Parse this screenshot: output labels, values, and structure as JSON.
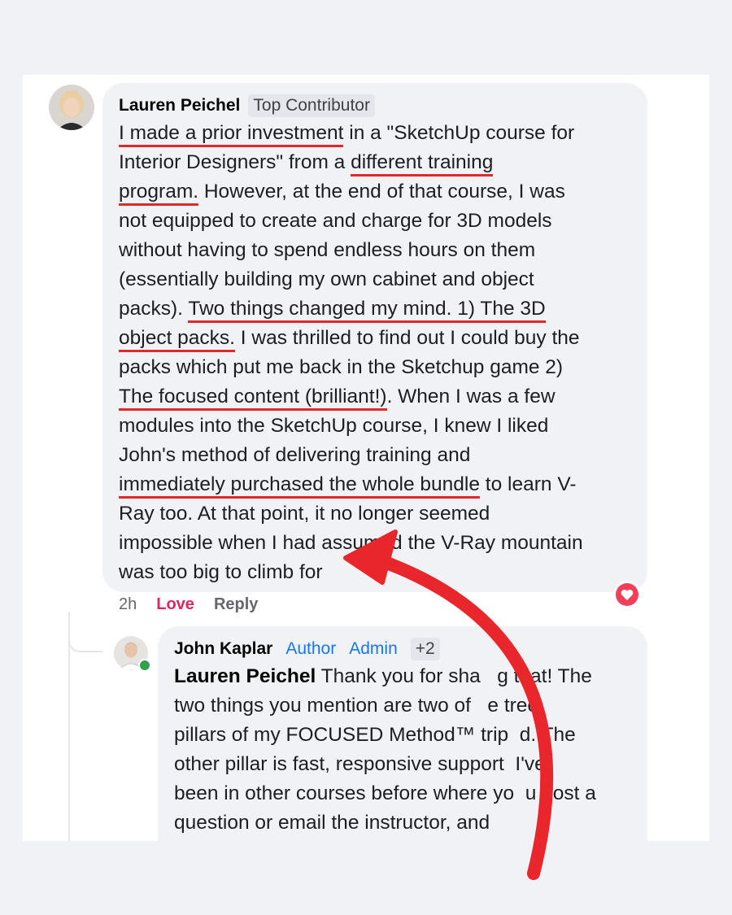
{
  "comment1": {
    "author": "Lauren Peichel",
    "badge": "Top Contributor",
    "lines": [
      [
        {
          "t": "I made a prior investment",
          "u": true
        },
        {
          "t": " in a \"SketchUp course for"
        }
      ],
      [
        {
          "t": "Interior Designers\" from a "
        },
        {
          "t": "different training",
          "u": true
        }
      ],
      [
        {
          "t": "program.",
          "u": true
        },
        {
          "t": " However, at the end of that course, I was"
        }
      ],
      [
        {
          "t": "not equipped to create and charge for 3D models"
        }
      ],
      [
        {
          "t": "without having to spend endless hours on them"
        }
      ],
      [
        {
          "t": "(essentially building my own cabinet and object"
        }
      ],
      [
        {
          "t": "packs). "
        },
        {
          "t": "Two things changed my mind. 1) The 3D",
          "u": true
        }
      ],
      [
        {
          "t": "object packs.",
          "u": true
        },
        {
          "t": " I was thrilled to find out I could buy the"
        }
      ],
      [
        {
          "t": "packs which put me back in the Sketchup game 2)"
        }
      ],
      [
        {
          "t": "The focused content (brilliant!)",
          "u": true
        },
        {
          "t": ". When I was a few"
        }
      ],
      [
        {
          "t": "modules into the SketchUp course, I knew I liked"
        }
      ],
      [
        {
          "t": "John's method of delivering training and"
        }
      ],
      [
        {
          "t": "immediately purchased the whole bundle",
          "u": true
        },
        {
          "t": " to learn V-"
        }
      ],
      [
        {
          "t": "Ray too. At that point, it no longer seemed"
        }
      ],
      [
        {
          "t": "impossible when I had assumed the V-Ray mountain"
        }
      ],
      [
        {
          "t": "was too big to climb for"
        }
      ]
    ],
    "timestamp": "2h",
    "reaction_label": "Love",
    "reply_label": "Reply"
  },
  "comment2": {
    "author": "John Kaplar",
    "badges": [
      "Author",
      "Admin"
    ],
    "extra_badges": "+2",
    "mention": "Lauren Peichel",
    "lines": [
      " Thank you for sha   g that! The",
      "two things you mention are two of   e tree",
      "pillars of my FOCUSED Method™ trip  d. The",
      "other pillar is fast, responsive support  I've",
      "been in other courses before where yo  u post a",
      "question or email the instructor, and"
    ]
  },
  "colors": {
    "underline": "#e02a2a",
    "arrow": "#e8262b",
    "love": "#e0245e",
    "badge_blue": "#1877f2"
  },
  "icons": {
    "reaction": "heart-icon",
    "online": "online-dot-icon"
  }
}
